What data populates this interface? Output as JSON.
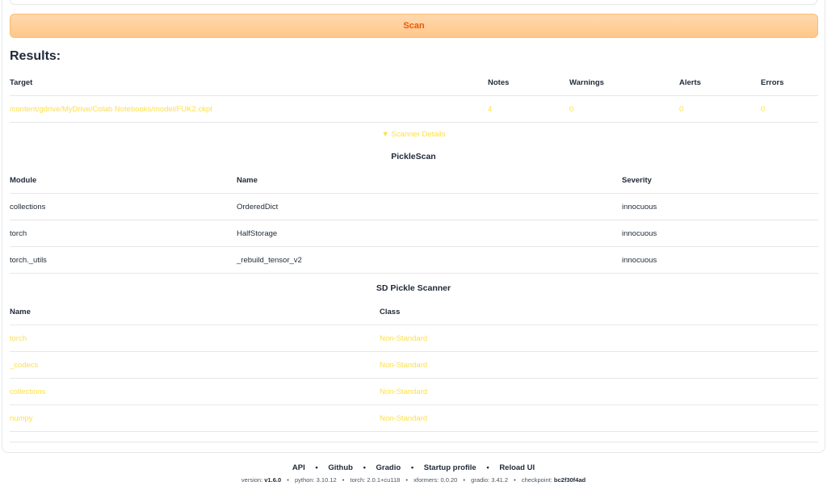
{
  "scan_button": "Scan",
  "results_title": "Results:",
  "results_table": {
    "headers": [
      "Target",
      "Notes",
      "Warnings",
      "Alerts",
      "Errors"
    ],
    "rows": [
      [
        "/content/gdrive/MyDrive/Colab Notebooks/model/FUK2.ckpt",
        "4",
        "0",
        "0",
        "0"
      ]
    ]
  },
  "scanner_details": "▼ Scanner Details",
  "picklescan": {
    "title": "PickleScan",
    "headers": [
      "Module",
      "Name",
      "Severity"
    ],
    "rows": [
      [
        "collections",
        "OrderedDict",
        "innocuous"
      ],
      [
        "torch",
        "HalfStorage",
        "innocuous"
      ],
      [
        "torch._utils",
        "_rebuild_tensor_v2",
        "innocuous"
      ]
    ]
  },
  "sd_pickle": {
    "title": "SD Pickle Scanner",
    "headers": [
      "Name",
      "Class"
    ],
    "rows": [
      [
        "torch",
        "Non-Standard"
      ],
      [
        "_codecs",
        "Non-Standard"
      ],
      [
        "collections",
        "Non-Standard"
      ],
      [
        "numpy",
        "Non-Standard"
      ]
    ]
  },
  "footer": {
    "links": [
      "API",
      "Github",
      "Gradio",
      "Startup profile",
      "Reload UI"
    ],
    "versions": [
      {
        "label": "version: ",
        "value": "v1.6.0",
        "bold": true
      },
      {
        "label": "python: ",
        "value": "3.10.12",
        "bold": false
      },
      {
        "label": "torch: ",
        "value": "2.0.1+cu118",
        "bold": false
      },
      {
        "label": "xformers: ",
        "value": "0.0.20",
        "bold": false
      },
      {
        "label": "gradio: ",
        "value": "3.41.2",
        "bold": false
      },
      {
        "label": "checkpoint: ",
        "value": "bc2f30f4ad",
        "bold": true
      }
    ]
  },
  "colors": {
    "accent": "#ea580c",
    "highlight": "#fde047"
  }
}
